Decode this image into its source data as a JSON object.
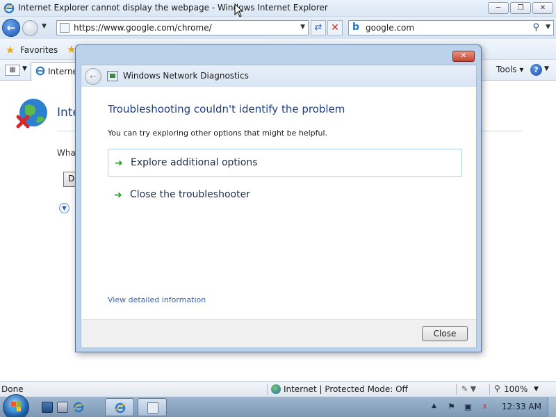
{
  "ie": {
    "window_title": "Internet Explorer cannot display the webpage - Windows Internet Explorer",
    "address": "https://www.google.com/chrome/",
    "search_text": "google.com",
    "favorites_label": "Favorites",
    "tab_label": "Internet",
    "tools_label": "Tools",
    "help_label": "?",
    "page": {
      "heading_partial": "Inte",
      "question_partial": "Wha",
      "button_partial": "D"
    }
  },
  "dialog": {
    "title": "Windows Network Diagnostics",
    "heading": "Troubleshooting couldn't identify the problem",
    "subtext": "You can try exploring other options that might be helpful.",
    "options": [
      {
        "label": "Explore additional options"
      },
      {
        "label": "Close the troubleshooter"
      }
    ],
    "detail_link": "View detailed information",
    "close_button": "Close"
  },
  "status_bar": {
    "status": "Done",
    "zone": "Internet | Protected Mode: Off",
    "zoom": "100%"
  },
  "taskbar": {
    "clock": "12:33 AM"
  },
  "icons": {
    "back": "back-arrow-icon",
    "forward": "forward-arrow-icon",
    "refresh": "refresh-icon",
    "stop": "stop-icon",
    "search": "search-icon",
    "favorites": "star-icon",
    "option_arrow": "green-arrow-icon"
  },
  "colors": {
    "dialog_heading": "#1e3d80",
    "link": "#3665ad",
    "option_arrow": "#2e9a2e"
  }
}
